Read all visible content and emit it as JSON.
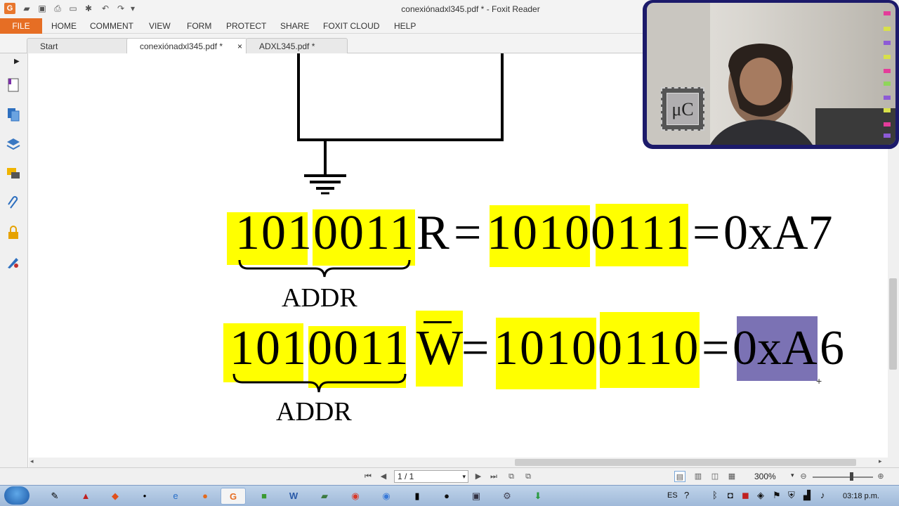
{
  "window": {
    "title": "conexiónadxl345.pdf * - Foxit Reader"
  },
  "menu": [
    "FILE",
    "HOME",
    "COMMENT",
    "VIEW",
    "FORM",
    "PROTECT",
    "SHARE",
    "FOXIT CLOUD",
    "HELP"
  ],
  "tabs": [
    {
      "label": "Start"
    },
    {
      "label": "conexiónadxl345.pdf *"
    },
    {
      "label": "ADXL345.pdf *"
    }
  ],
  "tab_close": "×",
  "document": {
    "line1": {
      "addr": "1010011",
      "bit": "R",
      "eq1": "=",
      "bin": "10100111",
      "eq2": "=",
      "hex": "0xA7",
      "brace_label": "ADDR"
    },
    "line2": {
      "addr": "1010011",
      "bit": "W",
      "eq1": "=",
      "bin": "10100110",
      "eq2": "=",
      "hex_selected": "0xA",
      "hex_rest": "6",
      "brace_label": "ADDR"
    },
    "highlight_color": "#ffff00",
    "selection_color": "#7b72b4"
  },
  "statusbar": {
    "page": "1 / 1",
    "zoom": "300%"
  },
  "webcam": {
    "logo": "μC"
  },
  "tray": {
    "lang": "ES",
    "time": "03:18 p.m."
  }
}
